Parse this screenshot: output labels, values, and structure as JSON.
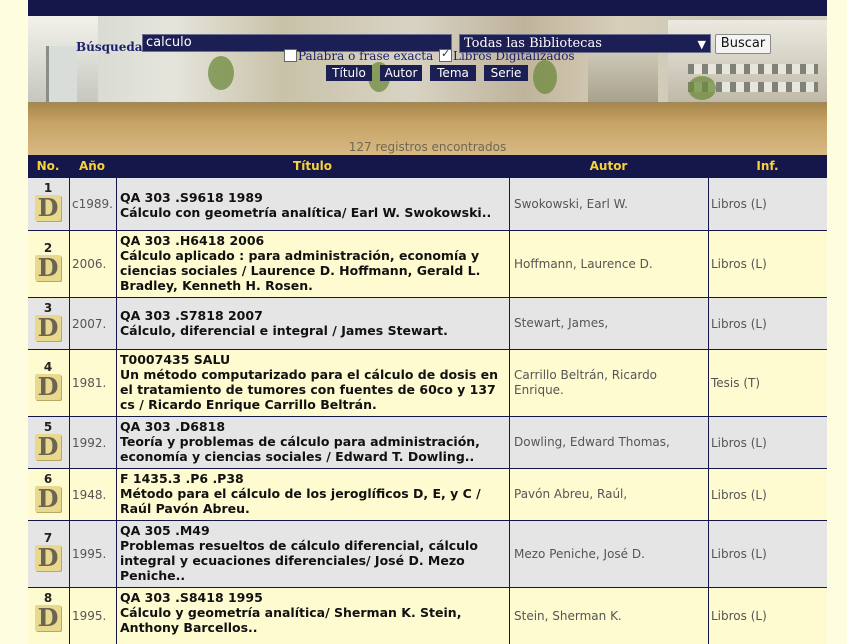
{
  "search": {
    "label": "Búsqueda:",
    "query": "calculo",
    "library_selected": "Todas las Bibliotecas",
    "button": "Buscar",
    "exact_phrase_label": "Palabra o frase exacta",
    "exact_phrase_checked": false,
    "digital_books_label": "Libros Digitalizados",
    "digital_books_checked": true,
    "fields": [
      "Título",
      "Autor",
      "Tema",
      "Serie"
    ]
  },
  "results": {
    "count_text": "127 registros encontrados",
    "headers": {
      "no": "No.",
      "year": "Año",
      "title": "Título",
      "author": "Autor",
      "inf": "Inf."
    },
    "badge": "D",
    "rows": [
      {
        "no": "1",
        "year": "c1989.",
        "call": "QA 303 .S9618 1989",
        "title": "Cálculo con geometría analítica/ Earl W. Swokowski..",
        "author": "Swokowski, Earl W.",
        "inf": "Libros (L)"
      },
      {
        "no": "2",
        "year": "2006.",
        "call": "QA 303 .H6418 2006",
        "title": "Cálculo aplicado : para administración, economía y ciencias sociales / Laurence D. Hoffmann, Gerald L. Bradley, Kenneth H. Rosen.",
        "author": "Hoffmann, Laurence D.",
        "inf": "Libros (L)"
      },
      {
        "no": "3",
        "year": "2007.",
        "call": "QA 303 .S7818 2007",
        "title": "Cálculo, diferencial e integral / James Stewart.",
        "author": "Stewart, James,",
        "inf": "Libros (L)"
      },
      {
        "no": "4",
        "year": "1981.",
        "call": "T0007435 SALU",
        "title": "Un método computarizado para el cálculo de dosis en el tratamiento de tumores con fuentes de 60co y 137 cs / Ricardo Enrique Carrillo Beltrán.",
        "author": "Carrillo Beltrán, Ricardo Enrique.",
        "inf": "Tesis (T)"
      },
      {
        "no": "5",
        "year": "1992.",
        "call": "QA 303 .D6818",
        "title": "Teoría y problemas de cálculo para administración, economía y ciencias sociales / Edward T. Dowling..",
        "author": "Dowling, Edward Thomas,",
        "inf": "Libros (L)"
      },
      {
        "no": "6",
        "year": "1948.",
        "call": "F 1435.3 .P6 .P38",
        "title": "Método para el cálculo de los jeroglíficos D, E, y C / Raúl Pavón Abreu.",
        "author": "Pavón Abreu, Raúl,",
        "inf": "Libros (L)"
      },
      {
        "no": "7",
        "year": "1995.",
        "call": "QA 305 .M49",
        "title": "Problemas resueltos de cálculo diferencial, cálculo integral y ecuaciones diferenciales/ José D. Mezo Peniche..",
        "author": "Mezo Peniche, José D.",
        "inf": "Libros (L)"
      },
      {
        "no": "8",
        "year": "1995.",
        "call": "QA 303 .S8418 1995",
        "title": "Cálculo y geometría analítica/ Sherman K. Stein, Anthony Barcellos..",
        "author": "Stein, Sherman K.",
        "inf": "Libros (L)"
      }
    ]
  }
}
